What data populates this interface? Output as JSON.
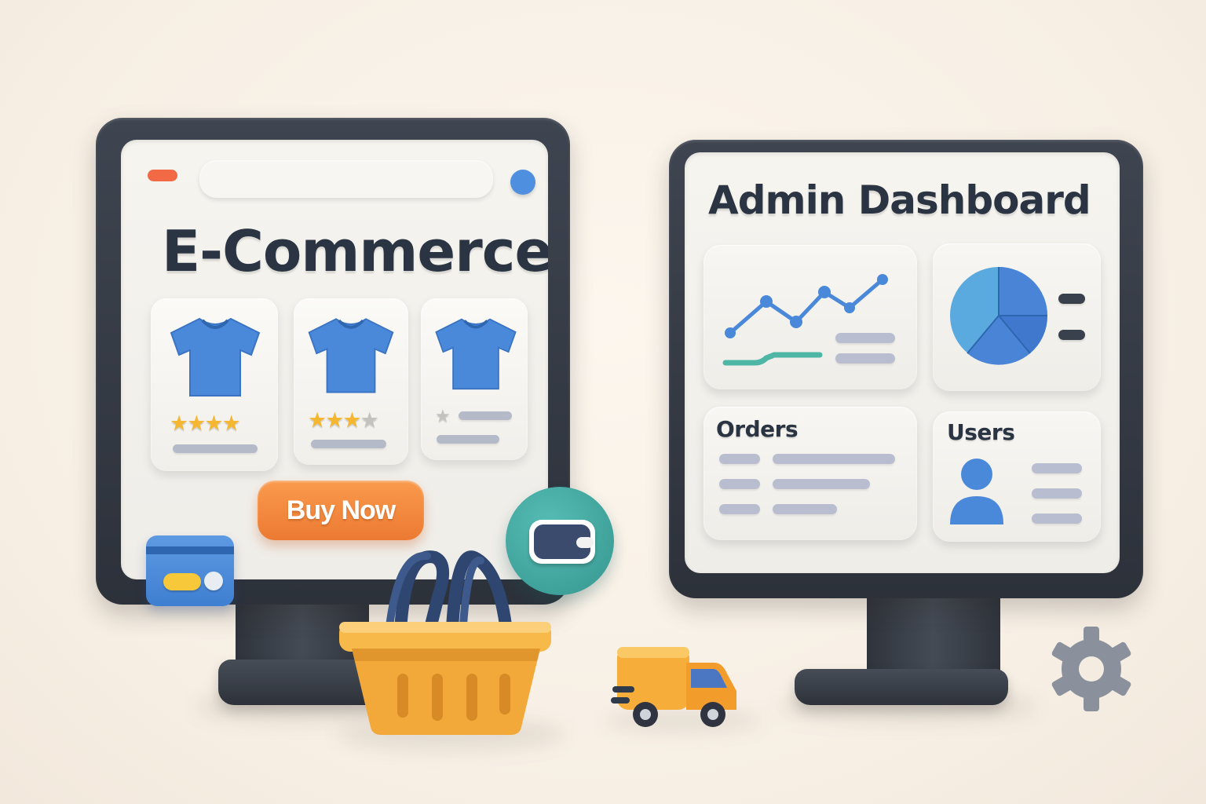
{
  "ecommerce": {
    "title": "E-Commerce",
    "buy_button": "Buy Now",
    "products": [
      {
        "icon": "tshirt-icon",
        "rating": 4,
        "max_rating": 4
      },
      {
        "icon": "tshirt-icon",
        "rating": 3,
        "max_rating": 4
      },
      {
        "icon": "tshirt-icon",
        "rating": 0,
        "max_rating": 1
      }
    ],
    "icons": [
      "credit-card-icon",
      "wallet-icon",
      "shopping-basket-icon"
    ]
  },
  "dashboard": {
    "title": "Admin Dashboard",
    "orders_label": "Orders",
    "users_label": "Users",
    "icons": [
      "line-chart-icon",
      "pie-chart-icon",
      "user-icon",
      "delivery-truck-icon",
      "gear-icon"
    ]
  },
  "colors": {
    "accent_blue": "#4a88d9",
    "accent_orange": "#f08a3e",
    "basket_yellow": "#f6b547",
    "teal": "#3fa7a0",
    "frame_dark": "#343a44"
  }
}
